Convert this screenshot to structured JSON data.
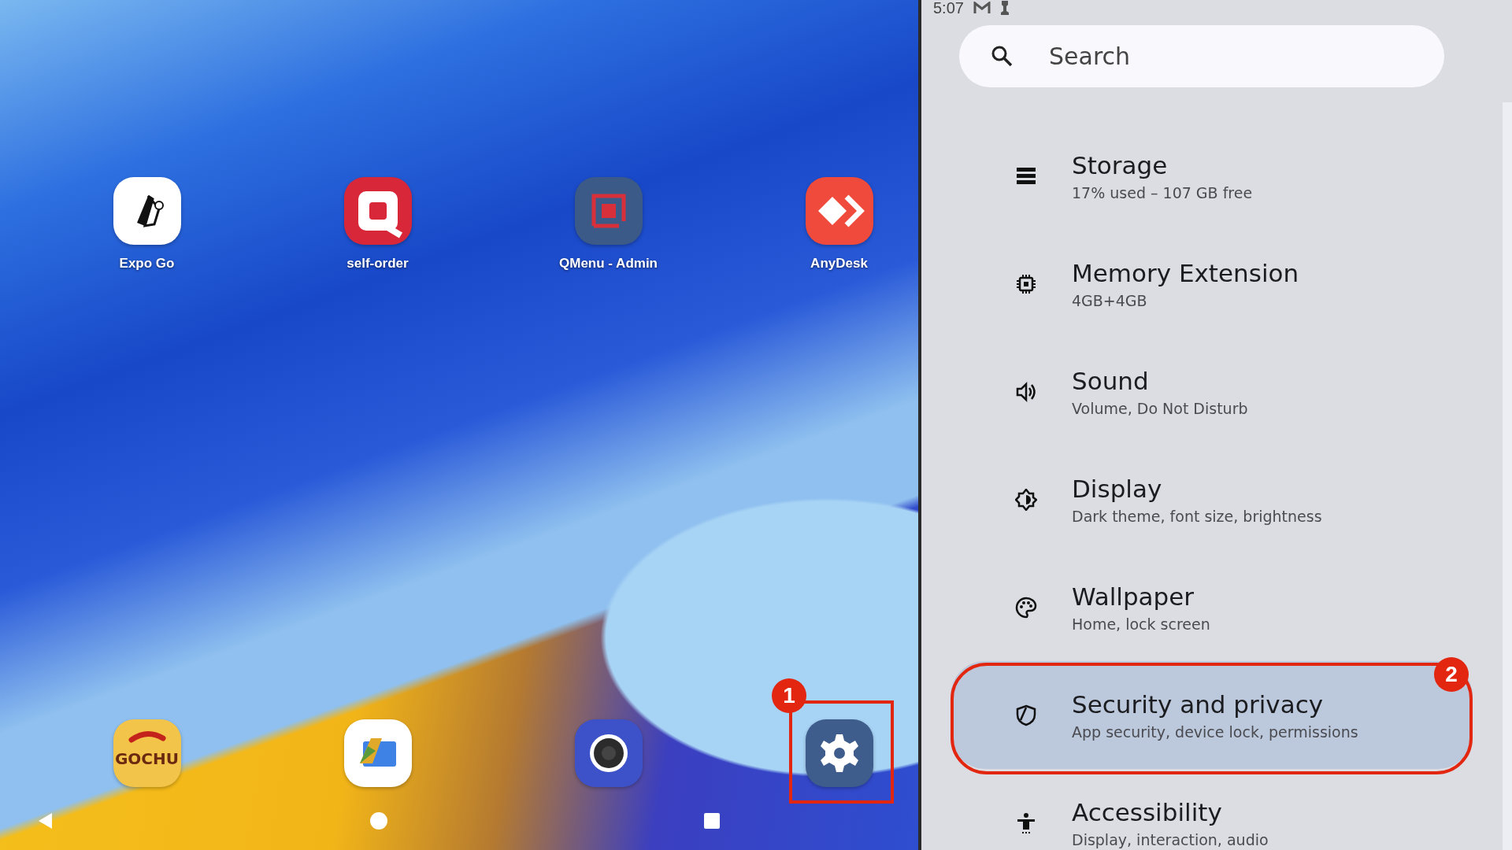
{
  "home_screen": {
    "apps": [
      {
        "kind": "expo",
        "label": "Expo Go"
      },
      {
        "kind": "selforder",
        "label": "self-order"
      },
      {
        "kind": "qmenu",
        "label": "QMenu - Admin"
      },
      {
        "kind": "anydesk",
        "label": "AnyDesk"
      }
    ],
    "dock": [
      {
        "kind": "gochu",
        "logo_text": "GOCHU"
      },
      {
        "kind": "files"
      },
      {
        "kind": "camera"
      },
      {
        "kind": "settings"
      }
    ]
  },
  "settings_screen": {
    "status_bar": {
      "time": "5:07"
    },
    "search": {
      "placeholder": "Search"
    },
    "items": [
      {
        "kind": "storage",
        "title": "Storage",
        "subtitle": "17% used – 107 GB free",
        "selected": false
      },
      {
        "kind": "memory",
        "title": "Memory Extension",
        "subtitle": "4GB+4GB",
        "selected": false
      },
      {
        "kind": "sound",
        "title": "Sound",
        "subtitle": "Volume, Do Not Disturb",
        "selected": false
      },
      {
        "kind": "display",
        "title": "Display",
        "subtitle": "Dark theme, font size, brightness",
        "selected": false
      },
      {
        "kind": "wallpaper",
        "title": "Wallpaper",
        "subtitle": "Home, lock screen",
        "selected": false
      },
      {
        "kind": "security",
        "title": "Security and privacy",
        "subtitle": "App security, device lock, permissions",
        "selected": true
      },
      {
        "kind": "accessibility",
        "title": "Accessibility",
        "subtitle": "Display, interaction, audio",
        "selected": false
      }
    ]
  },
  "annotations": [
    {
      "label": "1"
    },
    {
      "label": "2"
    }
  ]
}
